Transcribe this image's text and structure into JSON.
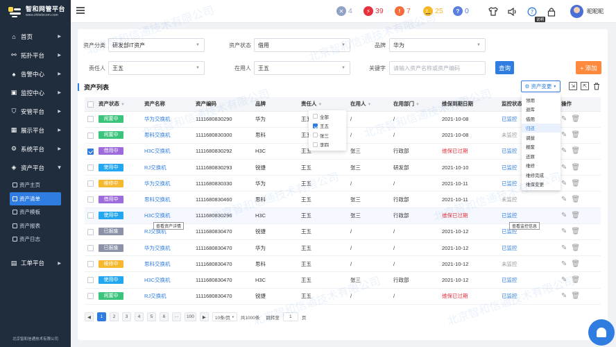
{
  "brand": {
    "title": "智和网管平台",
    "url": "www.zhitelecom.com",
    "footer": "北京智和信通技术有限公司"
  },
  "nav": [
    {
      "label": "首页",
      "icon": "home-icon",
      "glyph": "⌂"
    },
    {
      "label": "拓扑平台",
      "icon": "topology-icon",
      "glyph": "⚯"
    },
    {
      "label": "告警中心",
      "icon": "bell-icon",
      "glyph": "♠"
    },
    {
      "label": "监控中心",
      "icon": "monitor-icon",
      "glyph": "▣"
    },
    {
      "label": "安管平台",
      "icon": "shield-icon",
      "glyph": "⛉"
    },
    {
      "label": "展示平台",
      "icon": "grid-icon",
      "glyph": "▦"
    },
    {
      "label": "系统平台",
      "icon": "gear-icon",
      "glyph": "⚙"
    },
    {
      "label": "资产平台",
      "icon": "box-icon",
      "glyph": "◈"
    }
  ],
  "subnav": [
    "资产主页",
    "资产清单",
    "资产模板",
    "资产报表",
    "资产日志"
  ],
  "nav_last": {
    "label": "工单平台",
    "glyph": "▤"
  },
  "topbar": {
    "stats": [
      {
        "value": "4",
        "color": "#8fa3c7",
        "glyph": "✕",
        "name": "closed-count-icon"
      },
      {
        "value": "39",
        "color": "#e5323e",
        "glyph": "⚡",
        "name": "critical-count-icon"
      },
      {
        "value": "7",
        "color": "#f56c3a",
        "glyph": "!",
        "name": "warning-count-icon"
      },
      {
        "value": "25",
        "color": "#f5b82e",
        "glyph": "🔔",
        "name": "notice-count-icon"
      },
      {
        "value": "0",
        "color": "#5b7fe0",
        "glyph": "?",
        "name": "unknown-count-icon"
      }
    ],
    "help_label": "说明",
    "user": "昵昵昵"
  },
  "filters": {
    "asset_category_label": "资产分类",
    "asset_category_value": "研发部IT资产",
    "asset_status_label": "资产状态",
    "asset_status_value": "借用",
    "brand_label": "品牌",
    "brand_value": "华为",
    "owner_label": "责任人",
    "owner_value": "王五",
    "user_label": "在用人",
    "user_value": "王五",
    "keyword_label": "关键字",
    "keyword_placeholder": "请输入资产名称或资产编码",
    "query_button": "查询",
    "add_button": "+ 添加"
  },
  "list": {
    "title": "资产列表",
    "change_button": "资产变更",
    "columns": [
      "资产状态",
      "资产名称",
      "资产编码",
      "品牌",
      "责任人",
      "在用人",
      "在用部门",
      "维保到期日期",
      "监控状态",
      "操作"
    ],
    "rows": [
      {
        "status": "闲置中",
        "status_color": "#3cc47c",
        "name": "华为交换机",
        "code": "1111680830290",
        "brand": "华为",
        "owner": "王五",
        "user": "/",
        "dept": "/",
        "expire": "2021-10-08",
        "expire_warn": false,
        "monitor": "已监控",
        "monitor_on": true,
        "checked": false
      },
      {
        "status": "闲置中",
        "status_color": "#3cc47c",
        "name": "思科交换机",
        "code": "1111680830300",
        "brand": "思科",
        "owner": "王五",
        "user": "/",
        "dept": "/",
        "expire": "2021-10-08",
        "expire_warn": false,
        "monitor": "未监控",
        "monitor_on": false,
        "checked": false
      },
      {
        "status": "借用中",
        "status_color": "#9d6bdc",
        "name": "H3C交换机",
        "code": "1111680830292",
        "brand": "H3C",
        "owner": "王五",
        "user": "张三",
        "dept": "行政部",
        "expire": "维保已过期",
        "expire_warn": true,
        "monitor": "已监控",
        "monitor_on": true,
        "checked": true
      },
      {
        "status": "使用中",
        "status_color": "#22a7f0",
        "name": "RJ交换机",
        "code": "1111680830293",
        "brand": "锐捷",
        "owner": "王五",
        "user": "张三",
        "dept": "研发部",
        "expire": "2021-10-10",
        "expire_warn": false,
        "monitor": "已监控",
        "monitor_on": true,
        "checked": false
      },
      {
        "status": "维修中",
        "status_color": "#f5b82e",
        "name": "华为交换机",
        "code": "1111680830330",
        "brand": "华为",
        "owner": "王五",
        "user": "/",
        "dept": "/",
        "expire": "2021-10-11",
        "expire_warn": false,
        "monitor": "已监控",
        "monitor_on": true,
        "checked": false
      },
      {
        "status": "借用中",
        "status_color": "#9d6bdc",
        "name": "思科交换机",
        "code": "1111680830460",
        "brand": "思科",
        "owner": "王五",
        "user": "张三",
        "dept": "行政部",
        "expire": "2021-10-11",
        "expire_warn": false,
        "monitor": "未监控",
        "monitor_on": false,
        "checked": false
      },
      {
        "status": "使用中",
        "status_color": "#22a7f0",
        "name": "H3C交换机",
        "code": "1111680830296",
        "brand": "H3C",
        "owner": "王五",
        "user": "张三",
        "dept": "行政部",
        "expire": "维保已过期",
        "expire_warn": true,
        "monitor": "已监控",
        "monitor_on": true,
        "checked": false
      },
      {
        "status": "已报废",
        "status_color": "#8c93a8",
        "name": "RJ交换机",
        "code": "1111680830470",
        "brand": "锐捷",
        "owner": "王五",
        "user": "/",
        "dept": "/",
        "expire": "2021-10-12",
        "expire_warn": false,
        "monitor": "已监控",
        "monitor_on": true,
        "checked": false
      },
      {
        "status": "已报废",
        "status_color": "#8c93a8",
        "name": "华为交换机",
        "code": "1111680830470",
        "brand": "华为",
        "owner": "王五",
        "user": "/",
        "dept": "/",
        "expire": "2021-10-12",
        "expire_warn": false,
        "monitor": "已监控",
        "monitor_on": true,
        "checked": false
      },
      {
        "status": "维修中",
        "status_color": "#f5b82e",
        "name": "思科交换机",
        "code": "1111680830470",
        "brand": "思科",
        "owner": "王五",
        "user": "/",
        "dept": "/",
        "expire": "2021-10-12",
        "expire_warn": false,
        "monitor": "未监控",
        "monitor_on": false,
        "checked": false
      },
      {
        "status": "使用中",
        "status_color": "#22a7f0",
        "name": "H3C交换机",
        "code": "1111680830470",
        "brand": "H3C",
        "owner": "王五",
        "user": "张三",
        "dept": "行政部",
        "expire": "2021-10-12",
        "expire_warn": false,
        "monitor": "已监控",
        "monitor_on": true,
        "checked": false
      },
      {
        "status": "闲置中",
        "status_color": "#3cc47c",
        "name": "RJ交换机",
        "code": "1111680830470",
        "brand": "锐捷",
        "owner": "王五",
        "user": "/",
        "dept": "/",
        "expire": "维保已过期",
        "expire_warn": true,
        "monitor": "已监控",
        "monitor_on": true,
        "checked": false
      }
    ]
  },
  "owner_filter": {
    "options": [
      "全部",
      "王五",
      "张三",
      "李四"
    ],
    "checked_index": 1
  },
  "change_menu": {
    "options": [
      "领用",
      "退库",
      "借用",
      "归还",
      "调拔",
      "报废",
      "还原",
      "维修",
      "维修完成",
      "维保变更"
    ],
    "selected_index": 3
  },
  "tooltips": {
    "asset_detail": "查看资产详情",
    "monitor_info": "查看监控信息"
  },
  "pager": {
    "pages": [
      "1",
      "2",
      "3",
      "4",
      "5",
      "6",
      "···",
      "100"
    ],
    "active": "1",
    "page_size": "10条/页",
    "total": "共1000条",
    "jump_label": "跳转至",
    "jump_value": "1",
    "page_unit": "页"
  },
  "watermark": "北京智和信通技术有限公司"
}
